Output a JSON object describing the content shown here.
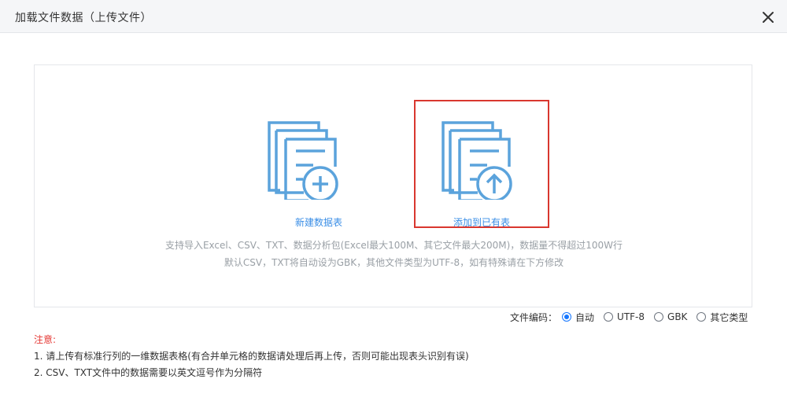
{
  "dialog": {
    "title": "加载文件数据（上传文件）"
  },
  "cards": {
    "new_table": {
      "label": "新建数据表",
      "icon": "new-table-doc-plus-icon"
    },
    "append_table": {
      "label": "添加到已有表",
      "icon": "append-doc-upload-icon"
    }
  },
  "hints": {
    "line1": "支持导入Excel、CSV、TXT、数据分析包(Excel最大100M、其它文件最大200M)，数据量不得超过100W行",
    "line2": "默认CSV，TXT将自动设为GBK，其他文件类型为UTF-8，如有特殊请在下方修改"
  },
  "encoding": {
    "label": "文件编码：",
    "selected": "自动",
    "options": [
      "自动",
      "UTF-8",
      "GBK",
      "其它类型"
    ]
  },
  "notes": {
    "title": "注意:",
    "line1": "1. 请上传有标准行列的一维数据表格(有合并单元格的数据请处理后再上传，否则可能出现表头识别有误)",
    "line2": "2. CSV、TXT文件中的数据需要以英文逗号作为分隔符"
  },
  "colors": {
    "accent": "#3a8ee6",
    "icon": "#5ba3dc",
    "highlight_border": "#d9372f",
    "notes_title": "#e53935",
    "radio_checked": "#1677ff"
  }
}
